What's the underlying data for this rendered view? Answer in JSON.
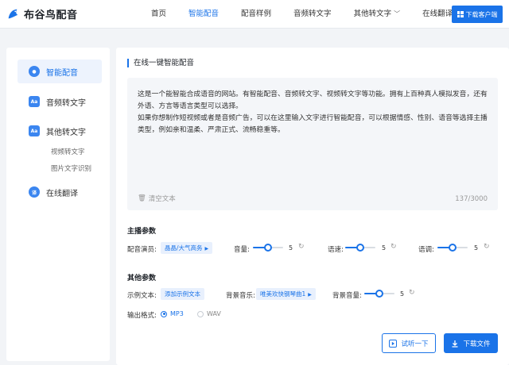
{
  "brand": {
    "name": "布谷鸟配音"
  },
  "nav": {
    "items": [
      {
        "label": "首页"
      },
      {
        "label": "智能配音"
      },
      {
        "label": "配音样例"
      },
      {
        "label": "音频转文字"
      },
      {
        "label": "其他转文字"
      },
      {
        "label": "在线翻译"
      }
    ],
    "download_client": "下载客户端"
  },
  "sidebar": {
    "items": [
      {
        "label": "智能配音"
      },
      {
        "label": "音频转文字"
      },
      {
        "label": "其他转文字"
      },
      {
        "label": "在线翻译"
      }
    ],
    "subitems": [
      {
        "label": "视频转文字"
      },
      {
        "label": "图片文字识别"
      }
    ]
  },
  "main": {
    "section_title": "在线一键智能配音",
    "text": "这是一个能智能合成语音的网站。有智能配音、音频转文字、视频转文字等功能。拥有上百种真人模拟发音，还有外语、方言等语言类型可以选择。\n如果你想制作短视频或者是音频广告，可以在这里输入文字进行智能配音，可以根据情感、性别、语音等选择主播类型，例如亲和温柔、严肃正式、流畅稳重等。",
    "clear_label": "清空文本",
    "counter": "137/3000",
    "anchor_group": {
      "title": "主播参数",
      "actor_label": "配音演员:",
      "actor_value": "晶晶/大气高务",
      "volume_label": "音量:",
      "volume_value": "5",
      "speed_label": "语速:",
      "speed_value": "5",
      "pitch_label": "语调:",
      "pitch_value": "5"
    },
    "other_group": {
      "title": "其他参数",
      "sample_label": "示例文本:",
      "sample_value": "添加示例文本",
      "bgm_label": "背景音乐:",
      "bgm_value": "唯美欢快钢琴曲1",
      "bgm_volume_label": "背景音量:",
      "bgm_volume_value": "5",
      "format_label": "输出格式:",
      "format_options": [
        "MP3",
        "WAV"
      ],
      "format_selected": "MP3"
    },
    "listen_button": "试听一下",
    "download_button": "下载文件"
  },
  "sliders": {
    "volume": 0.5,
    "speed": 0.5,
    "pitch": 0.5,
    "bgm_volume": 0.5
  },
  "colors": {
    "accent": "#1a73e8",
    "active_bg": "#edf3fd",
    "tag_bg": "#e8f0fd"
  }
}
